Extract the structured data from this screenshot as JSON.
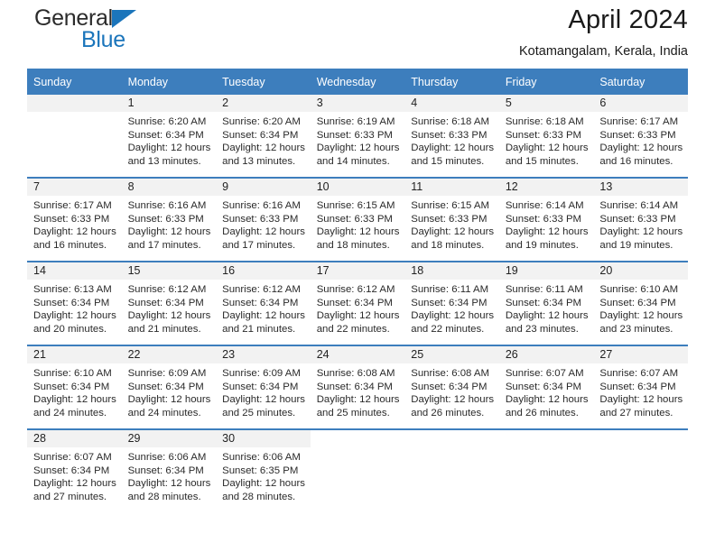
{
  "brand": {
    "line1": "General",
    "line2": "Blue",
    "triangle_color": "#1b75bb",
    "icon": "triangle-icon"
  },
  "header": {
    "title": "April 2024",
    "subtitle": "Kotamangalam, Kerala, India"
  },
  "colors": {
    "header_blue": "#3d7ebd",
    "daynum_bg": "#f2f2f2",
    "text": "#222222",
    "brand_blue": "#1b75bb"
  },
  "calendar": {
    "weekday_headers": [
      "Sunday",
      "Monday",
      "Tuesday",
      "Wednesday",
      "Thursday",
      "Friday",
      "Saturday"
    ],
    "weeks": [
      [
        {
          "day": "",
          "sunrise": "",
          "sunset": "",
          "daylight1": "",
          "daylight2": "",
          "empty": true
        },
        {
          "day": "1",
          "sunrise": "Sunrise: 6:20 AM",
          "sunset": "Sunset: 6:34 PM",
          "daylight1": "Daylight: 12 hours",
          "daylight2": "and 13 minutes."
        },
        {
          "day": "2",
          "sunrise": "Sunrise: 6:20 AM",
          "sunset": "Sunset: 6:34 PM",
          "daylight1": "Daylight: 12 hours",
          "daylight2": "and 13 minutes."
        },
        {
          "day": "3",
          "sunrise": "Sunrise: 6:19 AM",
          "sunset": "Sunset: 6:33 PM",
          "daylight1": "Daylight: 12 hours",
          "daylight2": "and 14 minutes."
        },
        {
          "day": "4",
          "sunrise": "Sunrise: 6:18 AM",
          "sunset": "Sunset: 6:33 PM",
          "daylight1": "Daylight: 12 hours",
          "daylight2": "and 15 minutes."
        },
        {
          "day": "5",
          "sunrise": "Sunrise: 6:18 AM",
          "sunset": "Sunset: 6:33 PM",
          "daylight1": "Daylight: 12 hours",
          "daylight2": "and 15 minutes."
        },
        {
          "day": "6",
          "sunrise": "Sunrise: 6:17 AM",
          "sunset": "Sunset: 6:33 PM",
          "daylight1": "Daylight: 12 hours",
          "daylight2": "and 16 minutes."
        }
      ],
      [
        {
          "day": "7",
          "sunrise": "Sunrise: 6:17 AM",
          "sunset": "Sunset: 6:33 PM",
          "daylight1": "Daylight: 12 hours",
          "daylight2": "and 16 minutes."
        },
        {
          "day": "8",
          "sunrise": "Sunrise: 6:16 AM",
          "sunset": "Sunset: 6:33 PM",
          "daylight1": "Daylight: 12 hours",
          "daylight2": "and 17 minutes."
        },
        {
          "day": "9",
          "sunrise": "Sunrise: 6:16 AM",
          "sunset": "Sunset: 6:33 PM",
          "daylight1": "Daylight: 12 hours",
          "daylight2": "and 17 minutes."
        },
        {
          "day": "10",
          "sunrise": "Sunrise: 6:15 AM",
          "sunset": "Sunset: 6:33 PM",
          "daylight1": "Daylight: 12 hours",
          "daylight2": "and 18 minutes."
        },
        {
          "day": "11",
          "sunrise": "Sunrise: 6:15 AM",
          "sunset": "Sunset: 6:33 PM",
          "daylight1": "Daylight: 12 hours",
          "daylight2": "and 18 minutes."
        },
        {
          "day": "12",
          "sunrise": "Sunrise: 6:14 AM",
          "sunset": "Sunset: 6:33 PM",
          "daylight1": "Daylight: 12 hours",
          "daylight2": "and 19 minutes."
        },
        {
          "day": "13",
          "sunrise": "Sunrise: 6:14 AM",
          "sunset": "Sunset: 6:33 PM",
          "daylight1": "Daylight: 12 hours",
          "daylight2": "and 19 minutes."
        }
      ],
      [
        {
          "day": "14",
          "sunrise": "Sunrise: 6:13 AM",
          "sunset": "Sunset: 6:34 PM",
          "daylight1": "Daylight: 12 hours",
          "daylight2": "and 20 minutes."
        },
        {
          "day": "15",
          "sunrise": "Sunrise: 6:12 AM",
          "sunset": "Sunset: 6:34 PM",
          "daylight1": "Daylight: 12 hours",
          "daylight2": "and 21 minutes."
        },
        {
          "day": "16",
          "sunrise": "Sunrise: 6:12 AM",
          "sunset": "Sunset: 6:34 PM",
          "daylight1": "Daylight: 12 hours",
          "daylight2": "and 21 minutes."
        },
        {
          "day": "17",
          "sunrise": "Sunrise: 6:12 AM",
          "sunset": "Sunset: 6:34 PM",
          "daylight1": "Daylight: 12 hours",
          "daylight2": "and 22 minutes."
        },
        {
          "day": "18",
          "sunrise": "Sunrise: 6:11 AM",
          "sunset": "Sunset: 6:34 PM",
          "daylight1": "Daylight: 12 hours",
          "daylight2": "and 22 minutes."
        },
        {
          "day": "19",
          "sunrise": "Sunrise: 6:11 AM",
          "sunset": "Sunset: 6:34 PM",
          "daylight1": "Daylight: 12 hours",
          "daylight2": "and 23 minutes."
        },
        {
          "day": "20",
          "sunrise": "Sunrise: 6:10 AM",
          "sunset": "Sunset: 6:34 PM",
          "daylight1": "Daylight: 12 hours",
          "daylight2": "and 23 minutes."
        }
      ],
      [
        {
          "day": "21",
          "sunrise": "Sunrise: 6:10 AM",
          "sunset": "Sunset: 6:34 PM",
          "daylight1": "Daylight: 12 hours",
          "daylight2": "and 24 minutes."
        },
        {
          "day": "22",
          "sunrise": "Sunrise: 6:09 AM",
          "sunset": "Sunset: 6:34 PM",
          "daylight1": "Daylight: 12 hours",
          "daylight2": "and 24 minutes."
        },
        {
          "day": "23",
          "sunrise": "Sunrise: 6:09 AM",
          "sunset": "Sunset: 6:34 PM",
          "daylight1": "Daylight: 12 hours",
          "daylight2": "and 25 minutes."
        },
        {
          "day": "24",
          "sunrise": "Sunrise: 6:08 AM",
          "sunset": "Sunset: 6:34 PM",
          "daylight1": "Daylight: 12 hours",
          "daylight2": "and 25 minutes."
        },
        {
          "day": "25",
          "sunrise": "Sunrise: 6:08 AM",
          "sunset": "Sunset: 6:34 PM",
          "daylight1": "Daylight: 12 hours",
          "daylight2": "and 26 minutes."
        },
        {
          "day": "26",
          "sunrise": "Sunrise: 6:07 AM",
          "sunset": "Sunset: 6:34 PM",
          "daylight1": "Daylight: 12 hours",
          "daylight2": "and 26 minutes."
        },
        {
          "day": "27",
          "sunrise": "Sunrise: 6:07 AM",
          "sunset": "Sunset: 6:34 PM",
          "daylight1": "Daylight: 12 hours",
          "daylight2": "and 27 minutes."
        }
      ],
      [
        {
          "day": "28",
          "sunrise": "Sunrise: 6:07 AM",
          "sunset": "Sunset: 6:34 PM",
          "daylight1": "Daylight: 12 hours",
          "daylight2": "and 27 minutes."
        },
        {
          "day": "29",
          "sunrise": "Sunrise: 6:06 AM",
          "sunset": "Sunset: 6:34 PM",
          "daylight1": "Daylight: 12 hours",
          "daylight2": "and 28 minutes."
        },
        {
          "day": "30",
          "sunrise": "Sunrise: 6:06 AM",
          "sunset": "Sunset: 6:35 PM",
          "daylight1": "Daylight: 12 hours",
          "daylight2": "and 28 minutes."
        },
        {
          "day": "",
          "sunrise": "",
          "sunset": "",
          "daylight1": "",
          "daylight2": "",
          "blank": true
        },
        {
          "day": "",
          "sunrise": "",
          "sunset": "",
          "daylight1": "",
          "daylight2": "",
          "blank": true
        },
        {
          "day": "",
          "sunrise": "",
          "sunset": "",
          "daylight1": "",
          "daylight2": "",
          "blank": true
        },
        {
          "day": "",
          "sunrise": "",
          "sunset": "",
          "daylight1": "",
          "daylight2": "",
          "blank": true
        }
      ]
    ]
  }
}
